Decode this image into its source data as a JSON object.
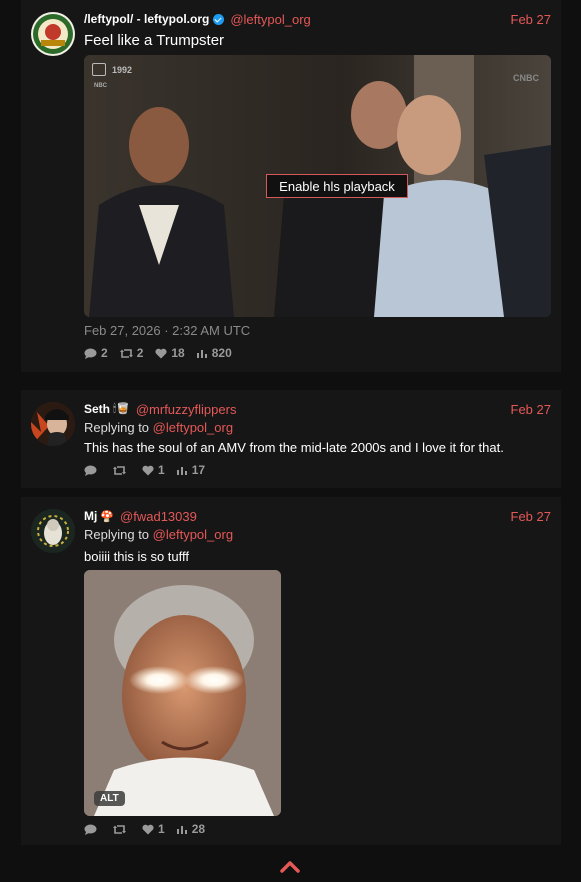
{
  "post": {
    "display_name": "/leftypol/ - leftypol.org",
    "handle": "@leftypol_org",
    "date": "Feb 27",
    "text": "Feel like a Trumpster",
    "video_year": "1992",
    "video_network": "NBC",
    "video_watermark": "CNBC",
    "hls_button": "Enable hls playback",
    "timestamp": "Feb 27, 2026 · 2:32 AM UTC",
    "stats": {
      "replies": "2",
      "retweets": "2",
      "likes": "18",
      "views": "820"
    }
  },
  "reply1": {
    "display_name": "Seth",
    "emoji": "🕯🥃",
    "handle": "@mrfuzzyflippers",
    "date": "Feb 27",
    "replying_prefix": "Replying to ",
    "replying_to": "@leftypol_org",
    "text": "This has the soul of an AMV from the mid-late 2000s and I love it for that.",
    "stats": {
      "replies": "",
      "retweets": "",
      "likes": "1",
      "views": "17"
    }
  },
  "reply2": {
    "display_name": "Mj",
    "emoji": "🍄",
    "handle": "@fwad13039",
    "date": "Feb 27",
    "replying_prefix": "Replying to ",
    "replying_to": "@leftypol_org",
    "text": "boiiii this is so tufff",
    "alt_badge": "ALT",
    "stats": {
      "replies": "",
      "retweets": "",
      "likes": "1",
      "views": "28"
    }
  },
  "colors": {
    "accent": "#e55858",
    "background": "#0f0f0f",
    "card": "#161616",
    "muted": "#9a9a9a"
  }
}
